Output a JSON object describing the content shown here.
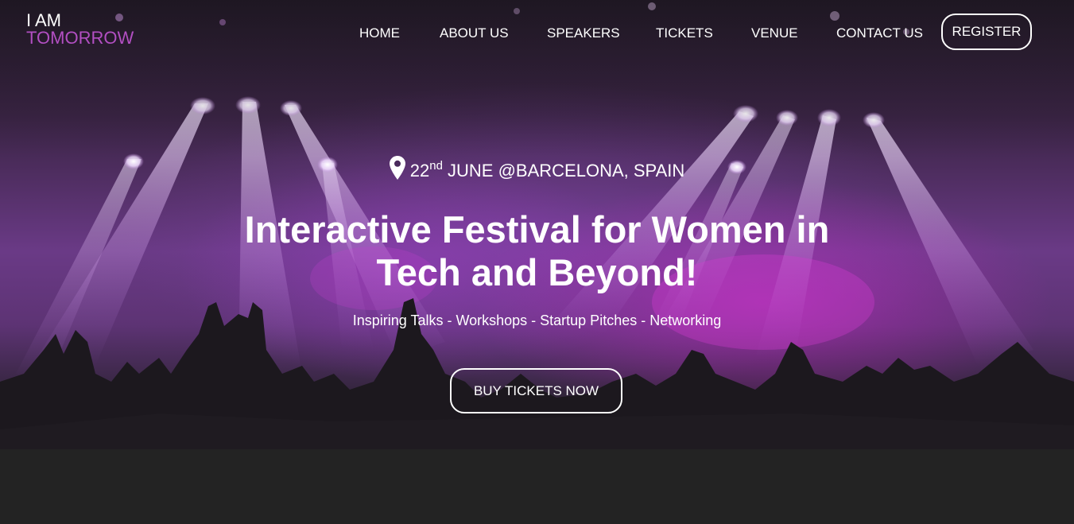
{
  "brand": {
    "line1": "I AM",
    "line2": "TOMORROW",
    "accent_color": "#b24fc2"
  },
  "nav": {
    "items": [
      {
        "label": "HOME"
      },
      {
        "label": "ABOUT US"
      },
      {
        "label": "SPEAKERS"
      },
      {
        "label": "TICKETS"
      },
      {
        "label": "VENUE"
      },
      {
        "label": "CONTACT US"
      }
    ],
    "register_label": "REGISTER"
  },
  "hero": {
    "location_icon": "map-pin-icon",
    "date_day": "22",
    "date_suffix": "nd",
    "date_rest": " JUNE @BARCELONA, SPAIN",
    "headline_line1": "Interactive Festival for Women in",
    "headline_line2": "Tech and Beyond!",
    "subline": "Inspiring Talks - Workshops - Startup Pitches - Networking",
    "cta_label": "BUY TICKETS NOW"
  },
  "colors": {
    "background": "#232323",
    "text": "#ffffff"
  }
}
